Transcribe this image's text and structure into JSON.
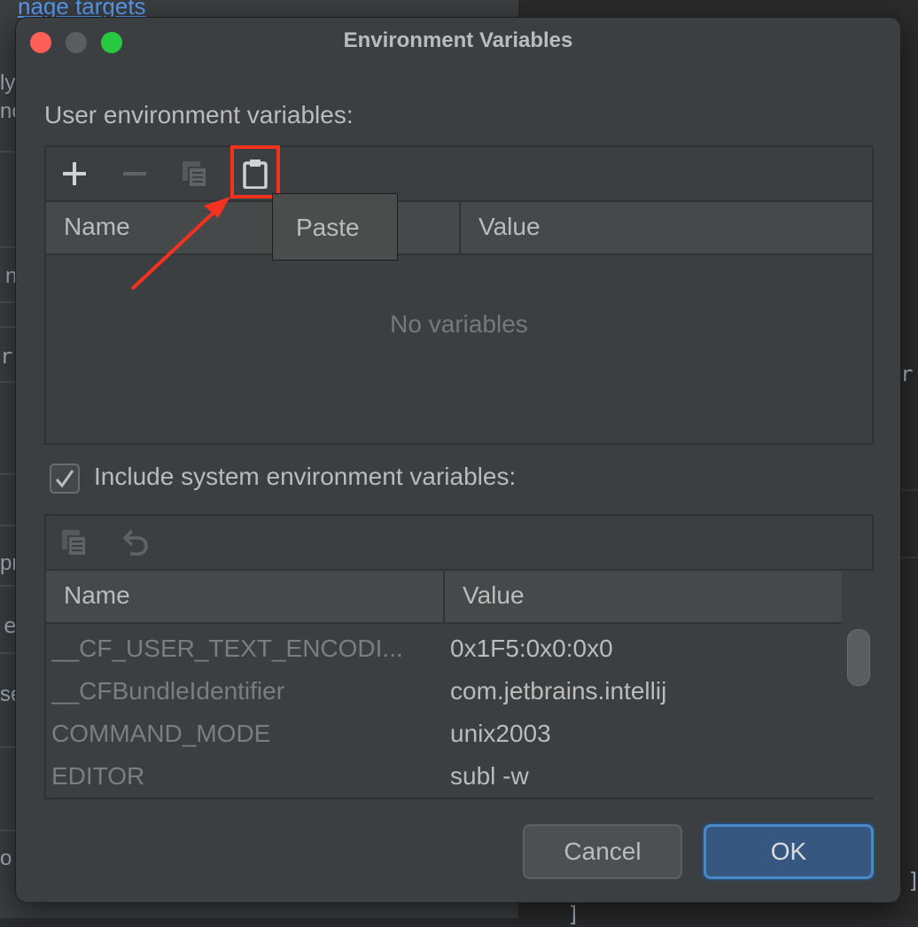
{
  "background": {
    "link_text": "nage targets",
    "left_fragments": [
      "ly",
      "nc",
      "n",
      "r",
      "pr",
      "e",
      "se",
      "o"
    ],
    "right_fragments": [
      "r",
      "]",
      "]"
    ]
  },
  "dialog": {
    "title": "Environment Variables",
    "user_section": {
      "label": "User environment variables:",
      "toolbar": {
        "add_icon": "plus-icon",
        "remove_icon": "minus-icon",
        "copy_icon": "copy-icon",
        "paste_icon": "clipboard-icon"
      },
      "tooltip": "Paste",
      "columns": [
        "Name",
        "Value"
      ],
      "empty_text": "No variables"
    },
    "include_system": {
      "checked": true,
      "label": "Include system environment variables:"
    },
    "system_section": {
      "toolbar": {
        "copy_icon": "copy-icon",
        "undo_icon": "undo-icon"
      },
      "columns": [
        "Name",
        "Value"
      ],
      "rows": [
        {
          "name": "__CF_USER_TEXT_ENCODI...",
          "value": "0x1F5:0x0:0x0"
        },
        {
          "name": "__CFBundleIdentifier",
          "value": "com.jetbrains.intellij"
        },
        {
          "name": "COMMAND_MODE",
          "value": "unix2003"
        },
        {
          "name": "EDITOR",
          "value": "subl -w"
        }
      ]
    },
    "buttons": {
      "cancel": "Cancel",
      "ok": "OK"
    }
  },
  "colors": {
    "annotation_red": "#f5311f",
    "ok_button": "#365880"
  }
}
